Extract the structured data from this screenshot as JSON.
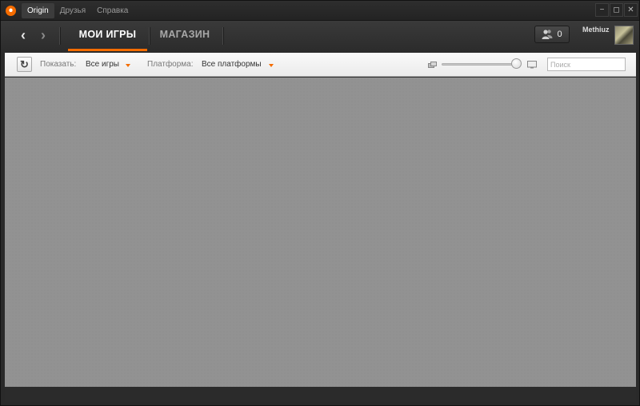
{
  "menu": {
    "items": [
      {
        "label": "Origin",
        "active": true
      },
      {
        "label": "Друзья",
        "active": false
      },
      {
        "label": "Справка",
        "active": false
      }
    ]
  },
  "window_controls": {
    "minimize": "−",
    "maximize": "◻",
    "close": "✕"
  },
  "nav": {
    "back_icon": "chevron-left-icon",
    "forward_icon": "chevron-right-icon",
    "tabs": [
      {
        "label": "МОИ ИГРЫ",
        "active": true
      },
      {
        "label": "МАГАЗИН",
        "active": false
      }
    ]
  },
  "friends": {
    "count": "0",
    "icon": "friends-icon"
  },
  "user": {
    "name": "Methiuz"
  },
  "toolbar": {
    "refresh_icon": "↻",
    "show_label": "Показать:",
    "show_value": "Все игры",
    "platform_label": "Платформа:",
    "platform_value": "Все платформы",
    "size_slider_value": 1.0,
    "search_placeholder": "Поиск"
  },
  "colors": {
    "accent": "#f56c00",
    "background": "#929292",
    "chrome": "#2a2a2a"
  }
}
